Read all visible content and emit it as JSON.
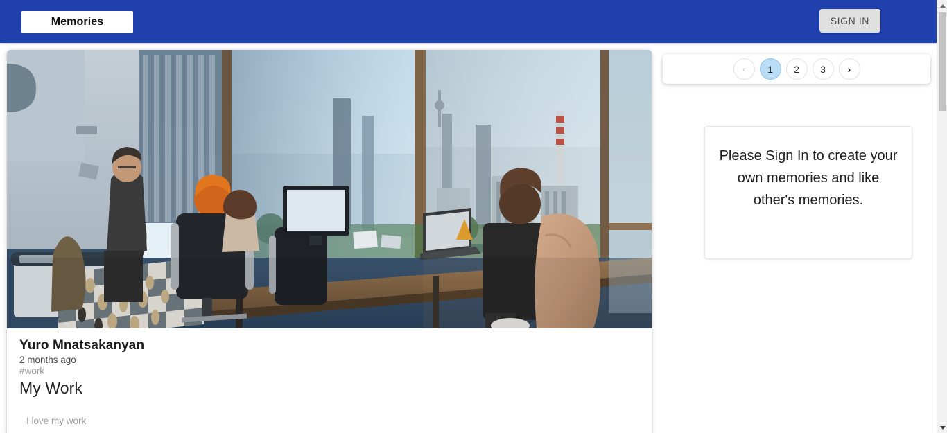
{
  "header": {
    "brand": "Memories",
    "signin_label": "SIGN IN",
    "background_color": "#2040ae",
    "brand_box_color": "#ffffff",
    "signin_button_color": "#e0e0e0"
  },
  "post": {
    "author": "Yuro Mnatsakanyan",
    "time_ago": "2 months ago",
    "tags": "#work",
    "title": "My Work",
    "message": "I love my work",
    "image_alt": "office-interior-photo"
  },
  "pagination": {
    "prev_icon": "chevron-left-icon",
    "next_icon": "chevron-right-icon",
    "prev_label": "‹",
    "next_label": "›",
    "pages": [
      "1",
      "2",
      "3"
    ],
    "current_page": "1",
    "current_color": "#bbdcf5"
  },
  "notice": {
    "text": "Please Sign In to create your own memories and like other's memories."
  },
  "scrollbar": {
    "up_arrow": "scroll-up-arrow",
    "down_arrow": "scroll-down-arrow",
    "thumb": "scroll-thumb"
  }
}
